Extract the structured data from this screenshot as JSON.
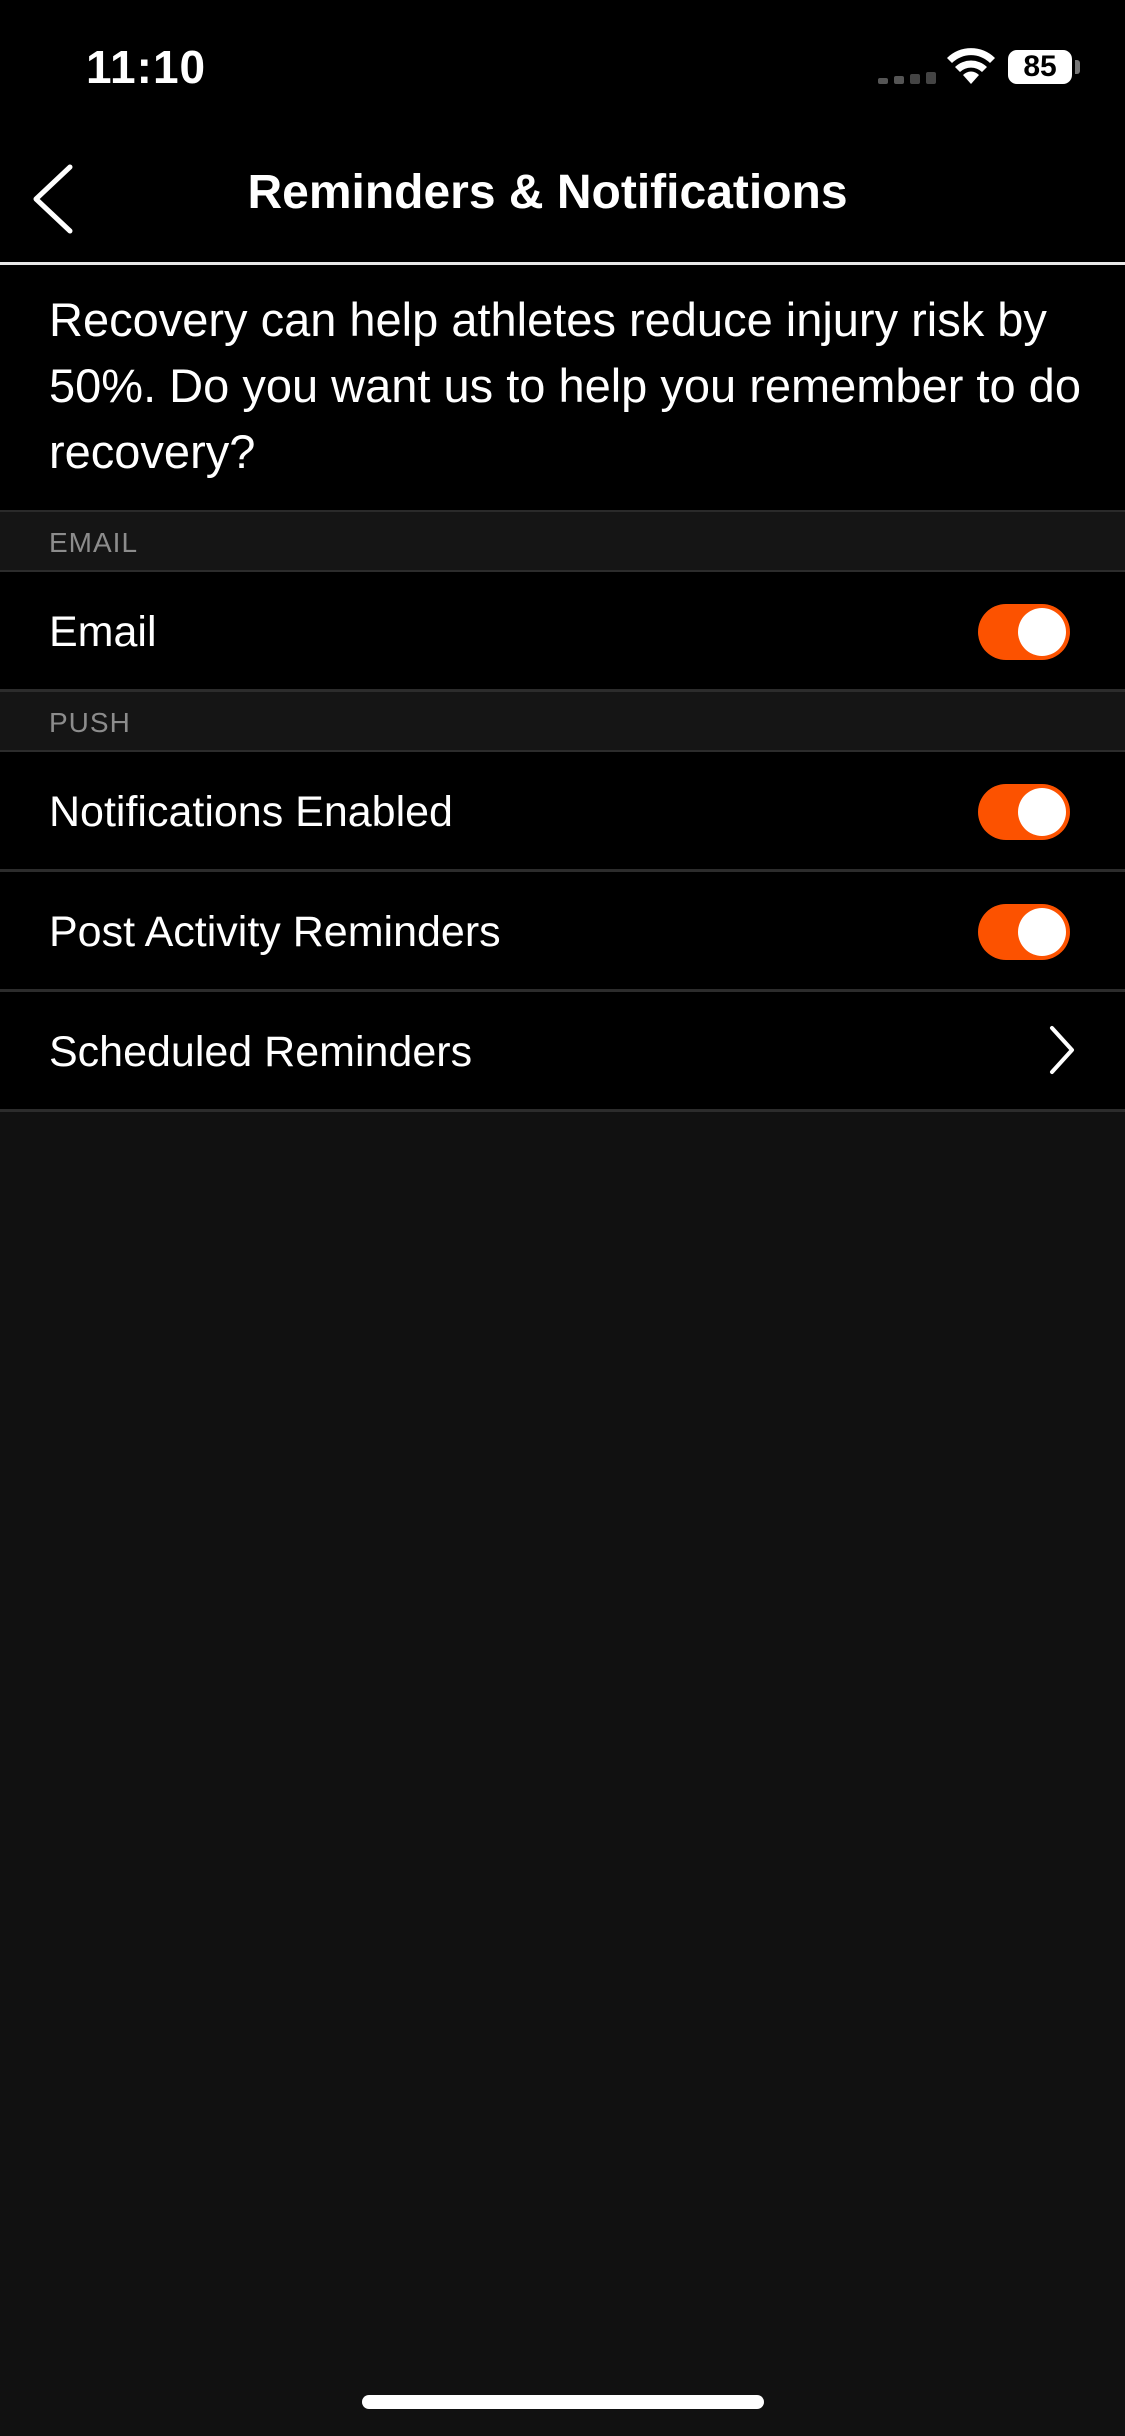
{
  "status_bar": {
    "time": "11:10",
    "battery": "85",
    "icons": [
      "cellular-signal-icon",
      "wifi-icon",
      "battery-icon"
    ]
  },
  "nav": {
    "title": "Reminders & Notifications",
    "back_icon": "chevron-left-icon"
  },
  "intro": {
    "text": "Recovery can help athletes reduce injury risk by 50%. Do you want us to help you remember to do recovery?"
  },
  "sections": {
    "email": {
      "header": "EMAIL",
      "rows": [
        {
          "label": "Email",
          "toggle_on": true
        }
      ]
    },
    "push": {
      "header": "PUSH",
      "rows": [
        {
          "label": "Notifications Enabled",
          "toggle_on": true
        },
        {
          "label": "Post Activity Reminders",
          "toggle_on": true
        },
        {
          "label": "Scheduled Reminders",
          "icon": "chevron-right-icon"
        }
      ]
    }
  },
  "colors": {
    "accent": "#fc5200",
    "background": "#000000",
    "empty_area": "#111111"
  }
}
